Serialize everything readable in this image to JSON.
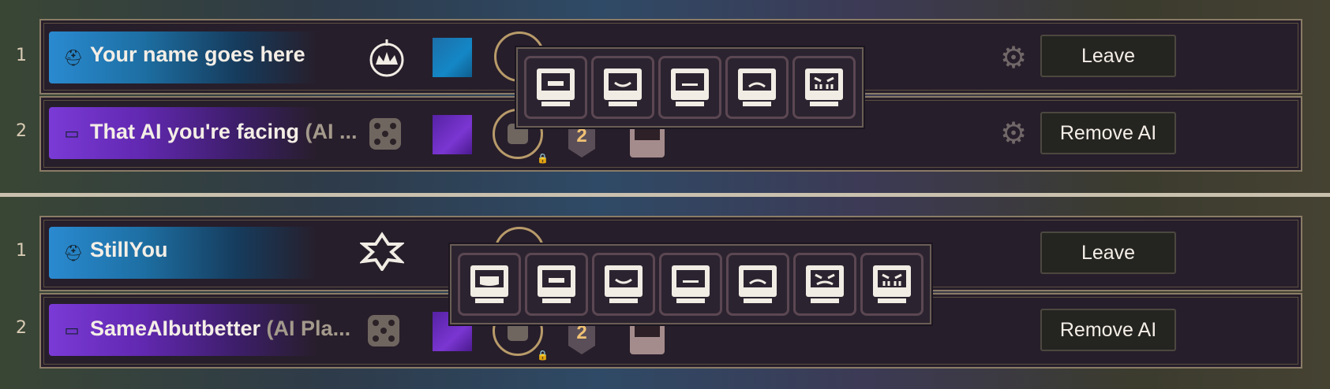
{
  "panels": [
    {
      "rows": [
        {
          "seat": "1",
          "name": "Your name goes here",
          "suffix": "",
          "button": "Leave",
          "kind": "human",
          "color": "#1d6fa3"
        },
        {
          "seat": "2",
          "name": "That AI you're facing",
          "suffix": " (AI ...",
          "button": "Remove AI",
          "kind": "ai",
          "color": "#6128b0",
          "team": "2"
        }
      ],
      "difficulty_faces": [
        "happy-face-icon",
        "smile-face-icon",
        "neutral-face-icon",
        "frown-face-icon",
        "angry-face-icon"
      ]
    },
    {
      "rows": [
        {
          "seat": "1",
          "name": "StillYou",
          "suffix": "",
          "button": "Leave",
          "kind": "human",
          "color": "#1d6fa3"
        },
        {
          "seat": "2",
          "name": "SameAIbutbetter",
          "suffix": " (AI Pla...",
          "button": "Remove AI",
          "kind": "ai",
          "color": "#6128b0",
          "team": "2"
        }
      ],
      "difficulty_faces": [
        "grin-face-icon",
        "happy-face-icon",
        "smile-face-icon",
        "neutral-face-icon",
        "frown-face-icon",
        "angry-face-icon",
        "furious-face-icon"
      ]
    }
  ]
}
